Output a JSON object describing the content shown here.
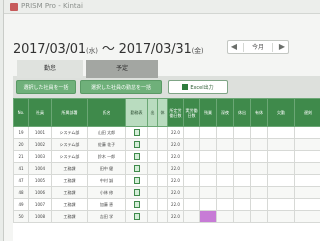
{
  "window": {
    "title": "PRISM Pro - Kintai"
  },
  "header": {
    "start_date": "2017/03/01",
    "start_dow": "(水)",
    "separator": "〜",
    "end_date": "2017/03/31",
    "end_dow": "(金)",
    "nav": {
      "prev": "◀",
      "label": "今月",
      "next": "▶"
    }
  },
  "tabs": [
    {
      "label": "勤怠"
    },
    {
      "label": "予定"
    }
  ],
  "toolbar": {
    "btn1": "選択した社員を一括",
    "btn2": "選択した社員の勤怠を一括",
    "btn3": "Excel出力"
  },
  "table": {
    "headers": [
      "No.",
      "社員",
      "所属部署",
      "氏名",
      "勤務表",
      "出",
      "休",
      "所定労働日数",
      "実労働日数",
      "残業",
      "深夜",
      "休出",
      "有休",
      "欠勤",
      "遅刻"
    ],
    "rows": [
      [
        "19",
        "1001",
        "システム部",
        "山田 太郎",
        "",
        "",
        "",
        "22.0",
        "",
        "",
        "",
        "",
        "",
        "",
        ""
      ],
      [
        "20",
        "1002",
        "システム部",
        "佐藤 花子",
        "",
        "",
        "",
        "22.0",
        "",
        "",
        "",
        "",
        "",
        "",
        ""
      ],
      [
        "21",
        "1003",
        "システム部",
        "鈴木 一郎",
        "",
        "",
        "",
        "22.0",
        "",
        "",
        "",
        "",
        "",
        "",
        ""
      ],
      [
        "41",
        "1004",
        "工務課",
        "田中 健",
        "",
        "",
        "",
        "22.0",
        "",
        "",
        "",
        "",
        "",
        "",
        ""
      ],
      [
        "47",
        "1005",
        "工務課",
        "中村 誠",
        "",
        "",
        "",
        "22.0",
        "",
        "",
        "",
        "",
        "",
        "",
        ""
      ],
      [
        "48",
        "1006",
        "工務課",
        "小林 修",
        "",
        "",
        "",
        "22.0",
        "",
        "",
        "",
        "",
        "",
        "",
        ""
      ],
      [
        "49",
        "1007",
        "工務課",
        "加藤 恵",
        "",
        "",
        "",
        "22.0",
        "",
        "",
        "",
        "",
        "",
        "",
        ""
      ],
      [
        "50",
        "1008",
        "工務課",
        "吉田 学",
        "",
        "",
        "",
        "22.0",
        "",
        "",
        "",
        "",
        "",
        "",
        ""
      ]
    ]
  },
  "colors": {
    "accent": "#3f8a4b",
    "mark": "#c77bd6"
  }
}
